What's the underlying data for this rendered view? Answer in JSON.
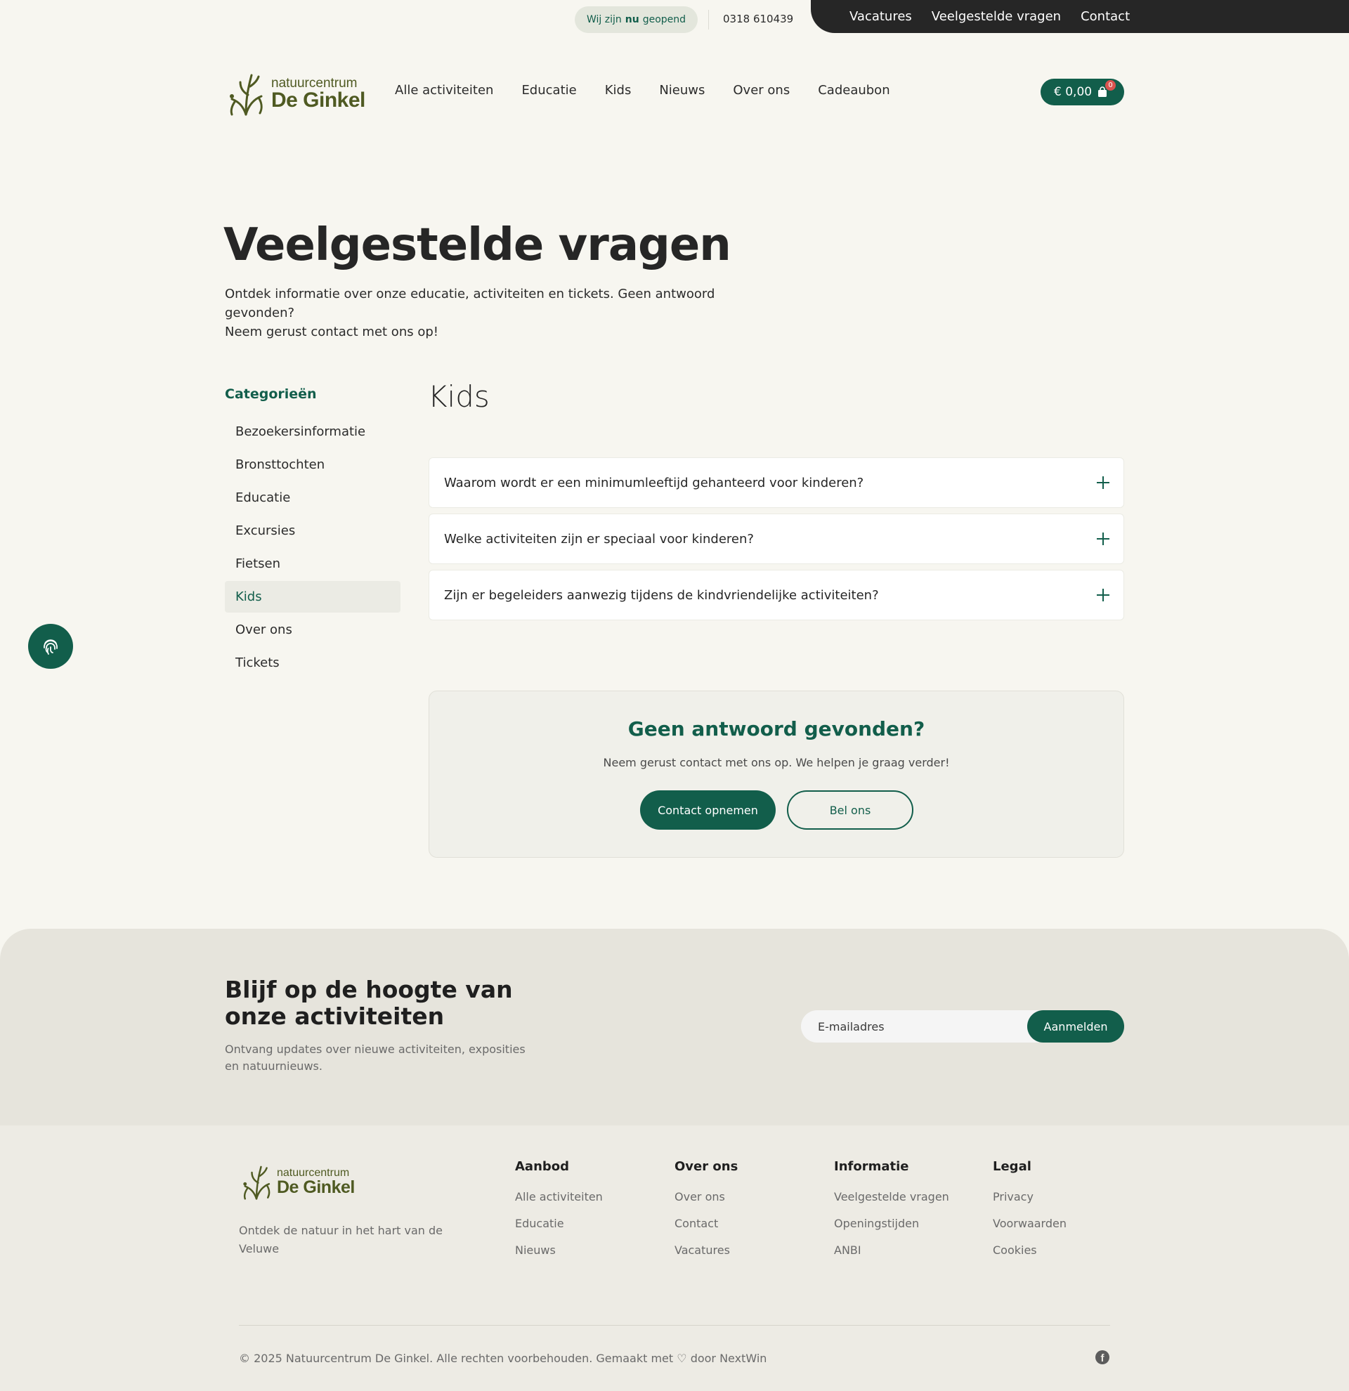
{
  "topbar": {
    "open_prefix": "Wij zijn",
    "open_strong": "nu",
    "open_suffix": "geopend",
    "phone": "0318 610439",
    "links": [
      "Vacatures",
      "Veelgestelde vragen",
      "Contact"
    ]
  },
  "brand": {
    "small": "natuurcentrum",
    "big": "De Ginkel",
    "color": "#4f5a22"
  },
  "nav": [
    "Alle activiteiten",
    "Educatie",
    "Kids",
    "Nieuws",
    "Over ons",
    "Cadeaubon"
  ],
  "cart": {
    "amount": "€ 0,00",
    "count": "0"
  },
  "hero": {
    "title": "Veelgestelde vragen",
    "intro_line1": "Ontdek informatie over onze educatie, activiteiten en tickets. Geen antwoord gevonden?",
    "intro_line2": "Neem gerust contact met ons op!"
  },
  "categories": {
    "title": "Categorieën",
    "items": [
      "Bezoekersinformatie",
      "Bronsttochten",
      "Educatie",
      "Excursies",
      "Fietsen",
      "Kids",
      "Over ons",
      "Tickets"
    ],
    "active": "Kids"
  },
  "faq": {
    "section_title": "Kids",
    "questions": [
      "Waarom wordt er een minimumleeftijd gehanteerd voor kinderen?",
      "Welke activiteiten zijn er speciaal voor kinderen?",
      "Zijn er begeleiders aanwezig tijdens de kindvriendelijke activiteiten?"
    ]
  },
  "help": {
    "title": "Geen antwoord gevonden?",
    "text": "Neem gerust contact met ons op. We helpen je graag verder!",
    "primary_label": "Contact opnemen",
    "secondary_label": "Bel ons"
  },
  "newsletter": {
    "title": "Blijf op de hoogte van onze activiteiten",
    "text": "Ontvang updates over nieuwe activiteiten, exposities en natuurnieuws.",
    "placeholder": "E-mailadres",
    "button": "Aanmelden"
  },
  "footer": {
    "description": "Ontdek de natuur in het hart van de Veluwe",
    "columns": [
      {
        "title": "Aanbod",
        "links": [
          "Alle activiteiten",
          "Educatie",
          "Nieuws"
        ]
      },
      {
        "title": "Over ons",
        "links": [
          "Over ons",
          "Contact",
          "Vacatures"
        ]
      },
      {
        "title": "Informatie",
        "links": [
          "Veelgestelde vragen",
          "Openingstijden",
          "ANBI"
        ]
      },
      {
        "title": "Legal",
        "links": [
          "Privacy",
          "Voorwaarden",
          "Cookies"
        ]
      }
    ],
    "copyright": "© 2025 Natuurcentrum De Ginkel. Alle rechten voorbehouden. Gemaakt met ♡ door NextWin",
    "social_icon": "facebook-icon"
  },
  "colors": {
    "brand_green": "#125e4b",
    "dark": "#262626",
    "background": "#f7f6f0"
  }
}
